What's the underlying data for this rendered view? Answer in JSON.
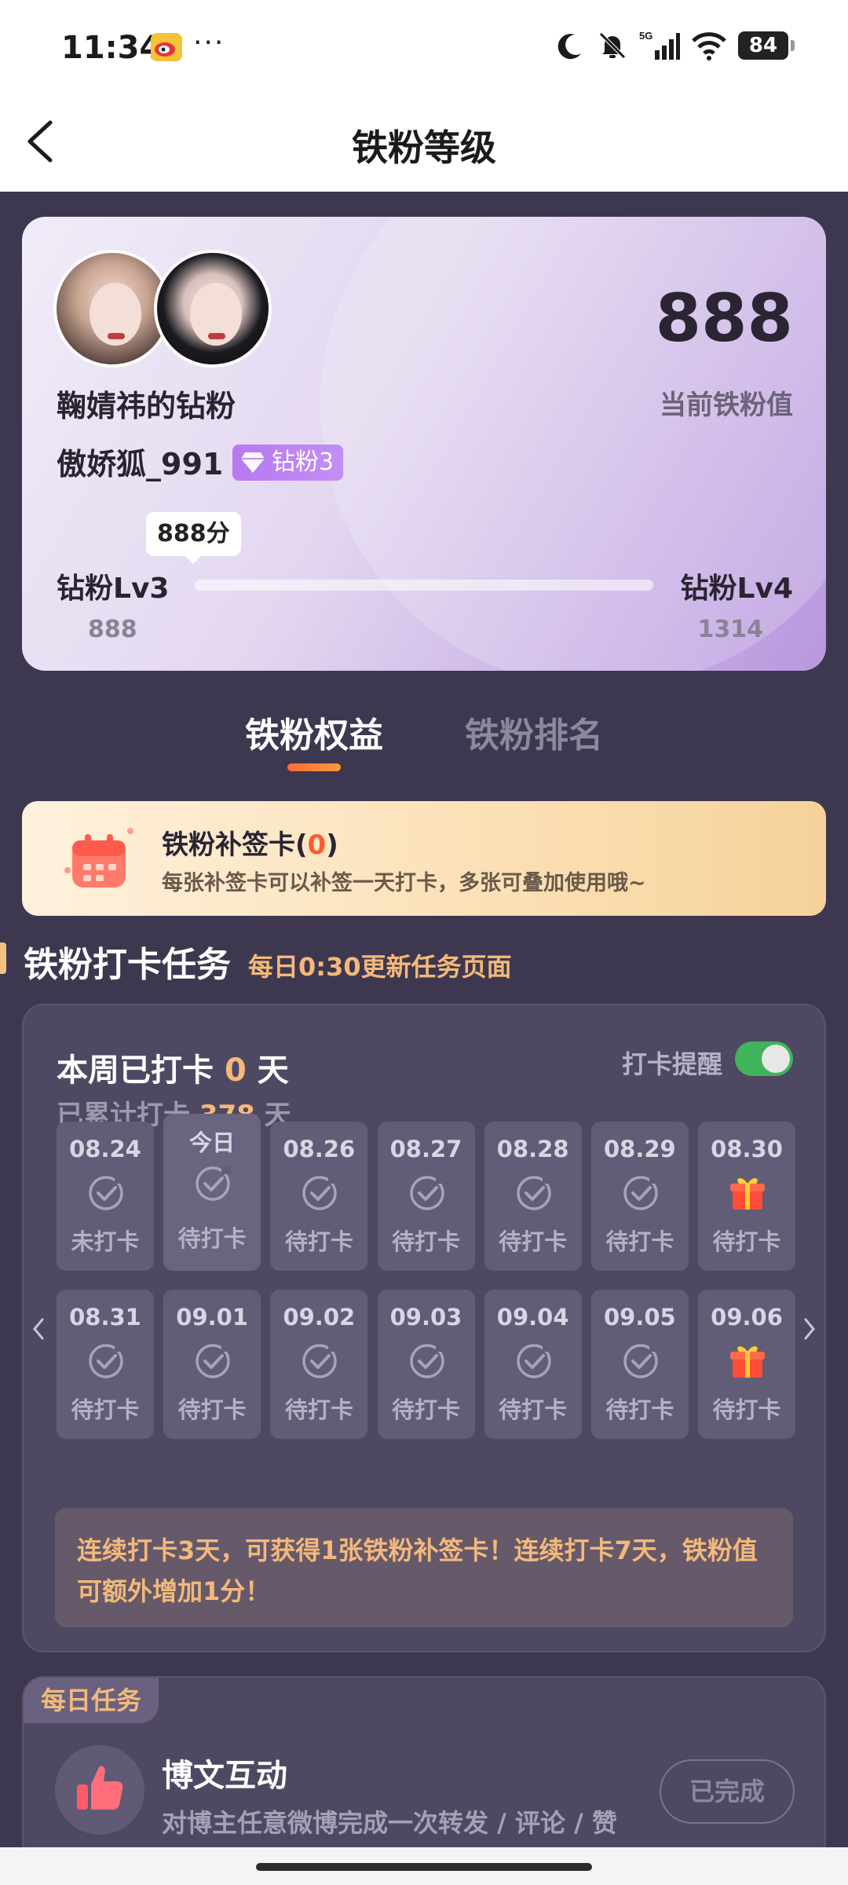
{
  "status_bar": {
    "time": "11:34",
    "more": "···",
    "network": "5G",
    "battery": "84"
  },
  "header": {
    "title": "铁粉等级"
  },
  "level_card": {
    "fan_name": "鞠婧祎的钻粉",
    "user_name": "傲娇狐_991",
    "badge": "钻粉3",
    "fan_value": "888",
    "fan_value_label": "当前铁粉值",
    "score_bubble": "888分",
    "current_level": "钻粉Lv3",
    "current_level_score": "888",
    "next_level": "钻粉Lv4",
    "next_level_score": "1314",
    "progress": 0.0
  },
  "tabs": [
    {
      "label": "铁粉权益",
      "active": true
    },
    {
      "label": "铁粉排名",
      "active": false
    }
  ],
  "makeup_card": {
    "title": "铁粉补签卡(",
    "count": "0",
    "title_end": ")",
    "desc": "每张补签卡可以补签一天打卡，多张可叠加使用哦~"
  },
  "checkin_section": {
    "title": "铁粉打卡任务",
    "subtitle": "每日0:30更新任务页面"
  },
  "checkin_panel": {
    "week_prefix": "本周已打卡",
    "week_days": "0",
    "week_suffix": "天",
    "total_prefix": "已累计打卡",
    "total_days": "378",
    "total_suffix": "天",
    "remind_label": "打卡提醒",
    "remind_on": true,
    "days": [
      {
        "date": "08.24",
        "status": "未打卡",
        "icon": "check-circle"
      },
      {
        "date": "今日",
        "status": "待打卡",
        "icon": "check-circle"
      },
      {
        "date": "08.26",
        "status": "待打卡",
        "icon": "check-circle"
      },
      {
        "date": "08.27",
        "status": "待打卡",
        "icon": "check-circle"
      },
      {
        "date": "08.28",
        "status": "待打卡",
        "icon": "check-circle"
      },
      {
        "date": "08.29",
        "status": "待打卡",
        "icon": "check-circle"
      },
      {
        "date": "08.30",
        "status": "待打卡",
        "icon": "gift"
      },
      {
        "date": "08.31",
        "status": "待打卡",
        "icon": "check-circle"
      },
      {
        "date": "09.01",
        "status": "待打卡",
        "icon": "check-circle"
      },
      {
        "date": "09.02",
        "status": "待打卡",
        "icon": "check-circle"
      },
      {
        "date": "09.03",
        "status": "待打卡",
        "icon": "check-circle"
      },
      {
        "date": "09.04",
        "status": "待打卡",
        "icon": "check-circle"
      },
      {
        "date": "09.05",
        "status": "待打卡",
        "icon": "check-circle"
      },
      {
        "date": "09.06",
        "status": "待打卡",
        "icon": "gift"
      }
    ],
    "tip": "连续打卡3天，可获得1张铁粉补签卡！连续打卡7天，铁粉值可额外增加1分！"
  },
  "daily_task": {
    "tag": "每日任务",
    "title": "博文互动",
    "desc": "对博主任意微博完成一次转发 / 评论 / 赞",
    "button": "已完成"
  },
  "colors": {
    "page_bg": "#3d3850",
    "accent_orange": "#f3b97a",
    "toggle_green": "#3fb45b",
    "badge_purple": "#b679f0"
  }
}
